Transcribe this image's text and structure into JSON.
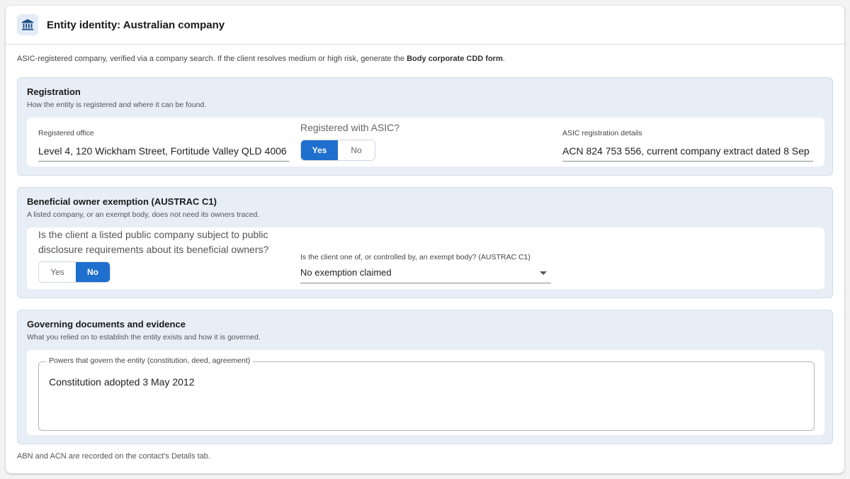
{
  "header": {
    "title": "Entity identity: Australian company",
    "icon": "bank-icon"
  },
  "intro": {
    "text": "ASIC-registered company, verified via a company search. If the client resolves medium or high risk, generate the ",
    "link_text": "Body corporate CDD form",
    "suffix": "."
  },
  "registration": {
    "title": "Registration",
    "subtitle": "How the entity is registered and where it can be found.",
    "office_label": "Registered office",
    "office_value": "Level 4, 120 Wickham Street, Fortitude Valley QLD 4006",
    "asic_question": "Registered with ASIC?",
    "asic_options": [
      "Yes",
      "No"
    ],
    "asic_selected": "Yes",
    "details_label": "ASIC registration details",
    "details_value": "ACN 824 753 556, current company extract dated 8 Sep"
  },
  "exemption": {
    "title": "Beneficial owner exemption (AUSTRAC C1)",
    "subtitle": "A listed company, or an exempt body, does not need its owners traced.",
    "listed_question": "Is the client a listed public company subject to public disclosure requirements about its beneficial owners?",
    "listed_options": [
      "Yes",
      "No"
    ],
    "listed_selected": "No",
    "exempt_label": "Is the client one of, or controlled by, an exempt body? (AUSTRAC C1)",
    "exempt_value": "No exemption claimed"
  },
  "governing": {
    "title": "Governing documents and evidence",
    "subtitle": "What you relied on to establish the entity exists and how it is governed.",
    "powers_label": "Powers that govern the entity (constitution, deed, agreement)",
    "powers_value": "Constitution adopted 3 May 2012"
  },
  "footnote": "ABN and ACN are recorded on the contact's Details tab.",
  "colors": {
    "accent": "#1f6fcf",
    "section_bg": "#e8eef6"
  }
}
